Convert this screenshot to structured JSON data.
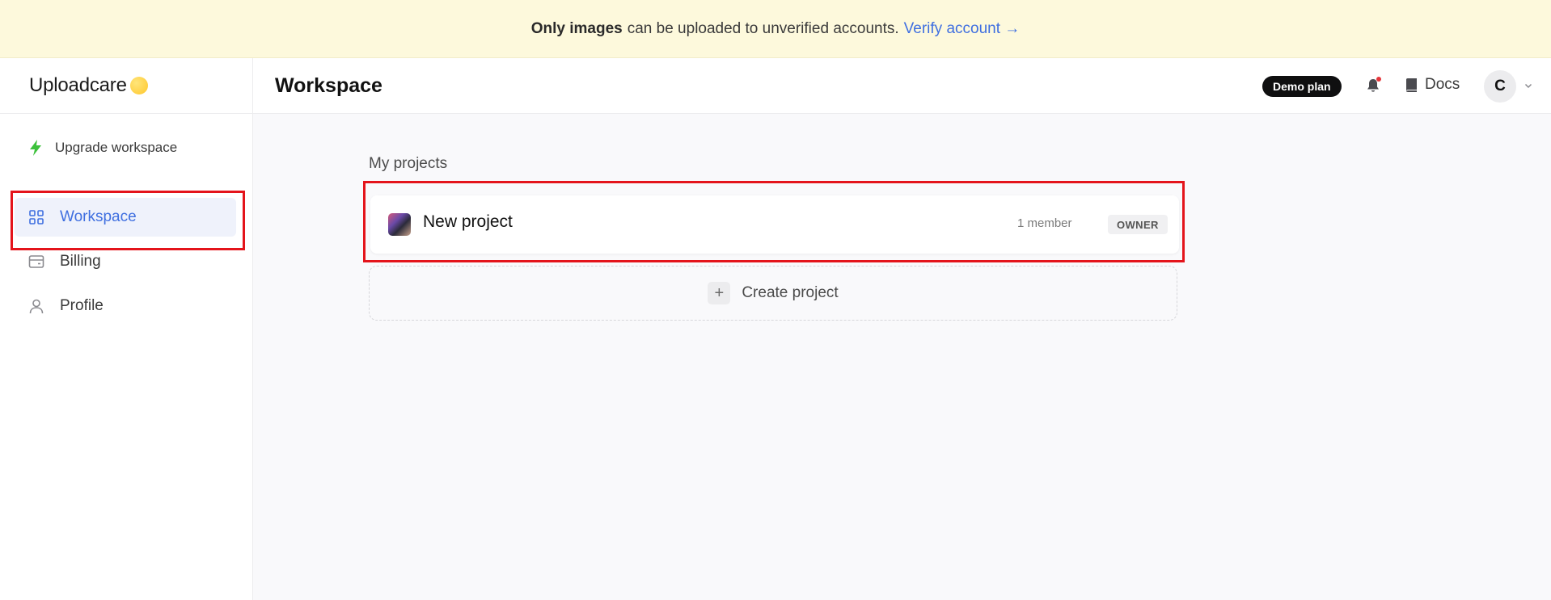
{
  "banner": {
    "bold_text": "Only images",
    "text": "can be uploaded to unverified accounts.",
    "link_text": "Verify account →"
  },
  "sidebar": {
    "logo_text": "Uploadcare",
    "upgrade_label": "Upgrade workspace",
    "items": [
      {
        "label": "Workspace",
        "icon": "grid-icon",
        "active": true
      },
      {
        "label": "Billing",
        "icon": "card-icon",
        "active": false
      },
      {
        "label": "Profile",
        "icon": "user-icon",
        "active": false
      }
    ]
  },
  "header": {
    "title": "Workspace",
    "plan_badge": "Demo plan",
    "docs_label": "Docs",
    "avatar_initial": "C"
  },
  "main": {
    "section_title": "My projects",
    "projects": [
      {
        "name": "New project",
        "members": "1 member",
        "role": "OWNER"
      }
    ],
    "create_label": "Create project",
    "create_icon": "+"
  },
  "colors": {
    "accent": "#3f6fe0",
    "banner_bg": "#fdf9dc",
    "highlight": "#e4141b",
    "upgrade_icon": "#3cc13b"
  }
}
